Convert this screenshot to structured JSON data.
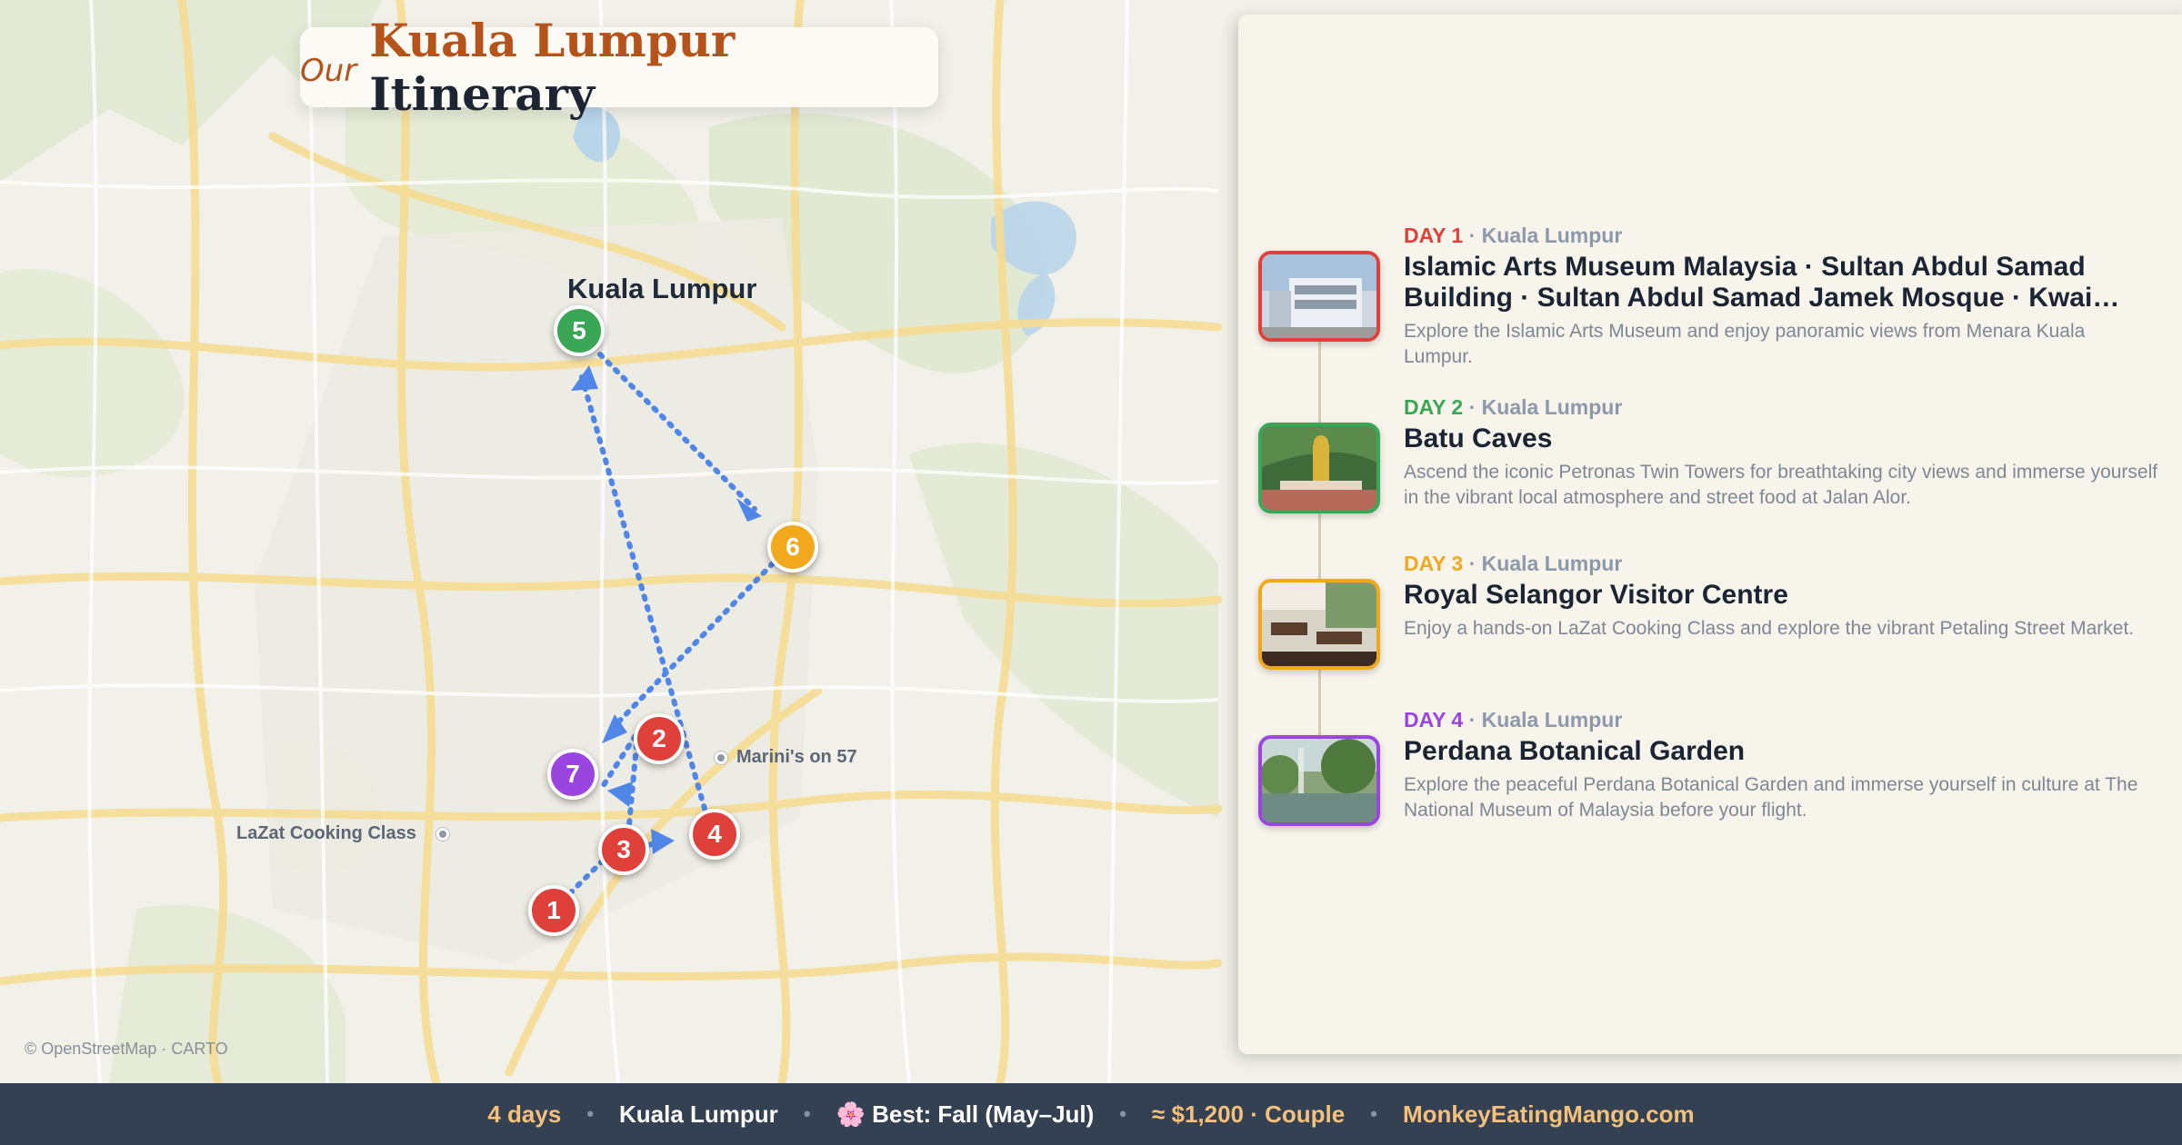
{
  "title": {
    "prefix": "Our",
    "city": "Kuala Lumpur",
    "suffix": "Itinerary"
  },
  "map": {
    "city_label": "Kuala Lumpur",
    "attribution": "© OpenStreetMap · CARTO",
    "pois": [
      {
        "label": "Marini's on 57"
      },
      {
        "label": "LaZat Cooking Class"
      }
    ],
    "markers": [
      {
        "number": "1",
        "color": "#e0403a"
      },
      {
        "number": "2",
        "color": "#e0403a"
      },
      {
        "number": "3",
        "color": "#e0403a"
      },
      {
        "number": "4",
        "color": "#e0403a"
      },
      {
        "number": "5",
        "color": "#3aa757"
      },
      {
        "number": "6",
        "color": "#f2a81d"
      },
      {
        "number": "7",
        "color": "#9b45e0"
      }
    ],
    "route_color": "#4f86e8"
  },
  "days": [
    {
      "label": "DAY 1",
      "location": "Kuala Lumpur",
      "color": "#e0403a",
      "title": "Islamic Arts Museum Malaysia · Sultan Abdul Samad Building · Sultan Abdul Samad Jamek Mosque · Kwai Chai…",
      "description": "Explore the Islamic Arts Museum and enjoy panoramic views from Menara Kuala Lumpur."
    },
    {
      "label": "DAY 2",
      "location": "Kuala Lumpur",
      "color": "#3aa757",
      "title": "Batu Caves",
      "description": "Ascend the iconic Petronas Twin Towers for breathtaking city views and immerse yourself in the vibrant local atmosphere and street food at Jalan Alor."
    },
    {
      "label": "DAY 3",
      "location": "Kuala Lumpur",
      "color": "#f2a81d",
      "title": "Royal Selangor Visitor Centre",
      "description": "Enjoy a hands-on LaZat Cooking Class and explore the vibrant Petaling Street Market."
    },
    {
      "label": "DAY 4",
      "location": "Kuala Lumpur",
      "color": "#9b45e0",
      "title": "Perdana Botanical Garden",
      "description": "Explore the peaceful Perdana Botanical Garden and immerse yourself in culture at The National Museum of Malaysia before your flight."
    }
  ],
  "footer": {
    "days": "4 days",
    "city": "Kuala Lumpur",
    "flower": "🌸",
    "best": "Best: Fall (May–Jul)",
    "budget": "≈ $1,200 · Couple",
    "site": "MonkeyEatingMango.com",
    "separator": "•"
  }
}
